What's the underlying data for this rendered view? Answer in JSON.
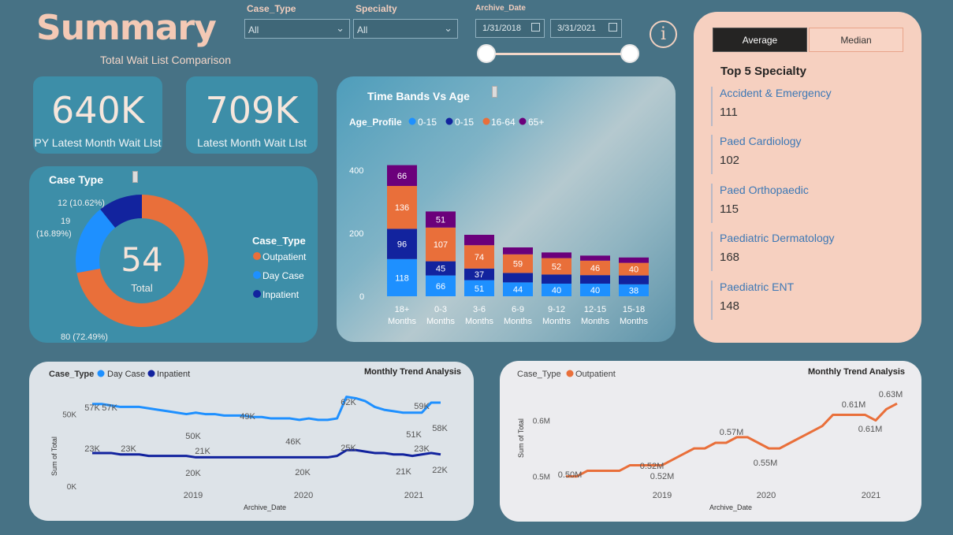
{
  "header": {
    "title": "Summary",
    "subtitle": "Total Wait List Comparison"
  },
  "slicers": {
    "case_type": {
      "label": "Case_Type",
      "value": "All"
    },
    "specialty": {
      "label": "Specialty",
      "value": "All"
    },
    "archive_date": {
      "label": "Archive_Date",
      "start": "1/31/2018",
      "end": "3/31/2021"
    }
  },
  "info_icon": "i",
  "kpis": [
    {
      "value": "640K",
      "label": "PY Latest Month Wait LIst"
    },
    {
      "value": "709K",
      "label": "Latest Month Wait LIst"
    }
  ],
  "case_type_panel": {
    "title": "Case Type",
    "center_value": "54",
    "center_label": "Total",
    "legend_title": "Case_Type",
    "slices": [
      {
        "name": "Outpatient",
        "value": 80,
        "label": "80 (72.49%)",
        "color": "#e96f3a"
      },
      {
        "name": "Day Case",
        "value": 19,
        "label_a": "19",
        "label_b": "(16.89%)",
        "color": "#1e90ff"
      },
      {
        "name": "Inpatient",
        "value": 12,
        "label": "12 (10.62%)",
        "color": "#12239e"
      }
    ]
  },
  "time_bands": {
    "title": "Time Bands Vs Age",
    "legend_title": "Age_Profile",
    "legend": [
      {
        "name": "0-15",
        "color": "#1e90ff"
      },
      {
        "name": "0-15",
        "color": "#12239e"
      },
      {
        "name": "16-64",
        "color": "#e96f3a"
      },
      {
        "name": "65+",
        "color": "#6b007b"
      }
    ],
    "y_ticks": [
      "400",
      "200",
      "0"
    ]
  },
  "chart_data": [
    {
      "type": "bar",
      "stacked": true,
      "title": "Time Bands Vs Age",
      "categories": [
        "18+ Months",
        "0-3 Months",
        "3-6 Months",
        "6-9 Months",
        "9-12 Months",
        "12-15 Months",
        "15-18 Months"
      ],
      "category_lines": [
        [
          "18+",
          "Months"
        ],
        [
          "0-3",
          "Months"
        ],
        [
          "3-6",
          "Months"
        ],
        [
          "6-9",
          "Months"
        ],
        [
          "9-12",
          "Months"
        ],
        [
          "12-15",
          "Months"
        ],
        [
          "15-18",
          "Months"
        ]
      ],
      "ylim": [
        0,
        420
      ],
      "series": [
        {
          "name": "0-15",
          "color": "#1e90ff",
          "values": [
            118,
            66,
            51,
            44,
            40,
            40,
            38
          ]
        },
        {
          "name": "0-15",
          "color": "#12239e",
          "values": [
            96,
            45,
            37,
            30,
            29,
            27,
            28
          ]
        },
        {
          "name": "16-64",
          "color": "#e96f3a",
          "values": [
            136,
            107,
            74,
            59,
            52,
            46,
            40
          ]
        },
        {
          "name": "65+",
          "color": "#6b007b",
          "values": [
            66,
            51,
            33,
            22,
            18,
            16,
            17
          ]
        }
      ],
      "data_labels": [
        [
          "118",
          "66",
          "51",
          "44",
          "40",
          "40",
          "38"
        ],
        [
          "96",
          "45",
          "37",
          "",
          "",
          "",
          ""
        ],
        [
          "136",
          "107",
          "74",
          "59",
          "52",
          "46",
          "40"
        ],
        [
          "66",
          "51",
          "",
          "",
          "",
          "",
          ""
        ]
      ]
    },
    {
      "type": "line",
      "title": "Monthly Trend Analysis",
      "xlabel": "Archive_Date",
      "ylabel": "Sum of Total",
      "x_ticks": [
        "2019",
        "2020",
        "2021"
      ],
      "y_ticks": [
        "50K",
        "0K"
      ],
      "legend_title": "Case_Type",
      "series": [
        {
          "name": "Day Case",
          "color": "#1e90ff",
          "values": [
            57,
            57,
            56,
            55,
            55,
            55,
            54,
            53,
            52,
            51,
            50,
            51,
            50,
            50,
            49,
            49,
            49,
            48,
            48,
            47,
            47,
            47,
            46,
            47,
            46,
            46,
            47,
            62,
            61,
            59,
            55,
            53,
            52,
            51,
            51,
            51,
            58,
            58
          ],
          "labels": [
            "57K",
            "57K",
            "50K",
            "49K",
            "46K",
            "62K",
            "59K",
            "51K",
            "58K"
          ]
        },
        {
          "name": "Inpatient",
          "color": "#12239e",
          "values": [
            23,
            23,
            23,
            22,
            22,
            22,
            21,
            21,
            21,
            21,
            21,
            20,
            20,
            20,
            20,
            20,
            20,
            20,
            20,
            20,
            20,
            20,
            20,
            20,
            20,
            20,
            21,
            25,
            25,
            24,
            23,
            23,
            22,
            22,
            21,
            22,
            23,
            22
          ],
          "labels": [
            "23K",
            "23K",
            "20K",
            "21K",
            "20K",
            "25K",
            "21K",
            "23K",
            "22K"
          ]
        }
      ]
    },
    {
      "type": "line",
      "title": "Monthly Trend Analysis",
      "xlabel": "Archive_Date",
      "ylabel": "Sum of Total",
      "x_ticks": [
        "2019",
        "2020",
        "2021"
      ],
      "y_ticks": [
        "0.6M",
        "0.5M"
      ],
      "legend_title": "Case_Type",
      "series": [
        {
          "name": "Outpatient",
          "color": "#e96f3a",
          "values": [
            0.5,
            0.5,
            0.51,
            0.51,
            0.51,
            0.51,
            0.52,
            0.52,
            0.52,
            0.52,
            0.53,
            0.54,
            0.55,
            0.55,
            0.56,
            0.56,
            0.57,
            0.57,
            0.56,
            0.55,
            0.55,
            0.56,
            0.57,
            0.58,
            0.59,
            0.61,
            0.61,
            0.61,
            0.61,
            0.6,
            0.62,
            0.63
          ],
          "labels": [
            "0.50M",
            "0.52M",
            "0.52M",
            "0.57M",
            "0.55M",
            "0.61M",
            "0.61M",
            "0.63M"
          ]
        }
      ]
    }
  ],
  "top5": {
    "buttons": {
      "average": "Average",
      "median": "Median"
    },
    "title": "Top 5 Specialty",
    "items": [
      {
        "name": "Accident & Emergency",
        "value": "111"
      },
      {
        "name": "Paed Cardiology",
        "value": "102"
      },
      {
        "name": "Paed Orthopaedic",
        "value": "115"
      },
      {
        "name": "Paediatric Dermatology",
        "value": "168"
      },
      {
        "name": "Paediatric ENT",
        "value": "148"
      }
    ]
  },
  "trend1": {
    "title": "Monthly Trend Analysis",
    "legend_title": "Case_Type",
    "legend": [
      "Day Case",
      "Inpatient"
    ],
    "xlabel": "Archive_Date",
    "ylabel": "Sum of Total"
  },
  "trend2": {
    "title": "Monthly Trend Analysis",
    "legend_title": "Case_Type",
    "legend": [
      "Outpatient"
    ],
    "xlabel": "Archive_Date",
    "ylabel": "Sum of Total"
  }
}
